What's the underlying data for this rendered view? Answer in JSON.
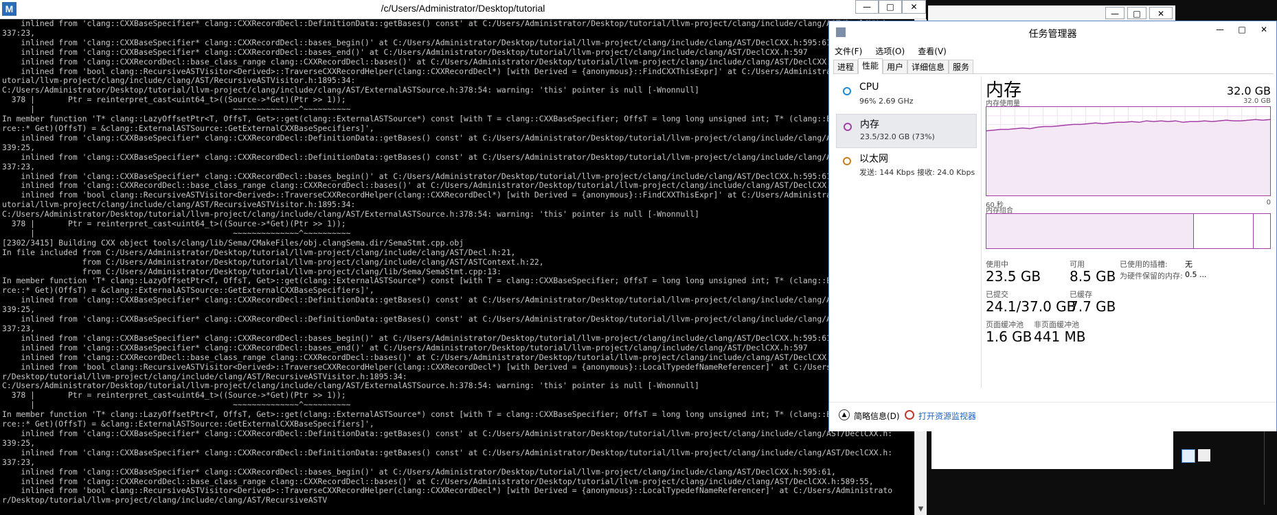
{
  "terminal": {
    "title": "/c/Users/Administrator/Desktop/tutorial",
    "app_icon": "M",
    "buttons": {
      "minimize": "—",
      "maximize": "□",
      "close": "✕"
    },
    "lines": [
      "    inlined from 'clang::CXXBaseSpecifier* clang::CXXRecordDecl::DefinitionData::getBases() const' at C:/Users/Administrator/Desktop/tutorial/llvm-project/clang/include/clang/AST/DeclCXX.h:",
      "337:23,",
      "    inlined from 'clang::CXXBaseSpecifier* clang::CXXRecordDecl::bases_begin()' at C:/Users/Administrator/Desktop/tutorial/llvm-project/clang/include/clang/AST/DeclCXX.h:595:61,",
      "    inlined from 'clang::CXXBaseSpecifier* clang::CXXRecordDecl::bases_end()' at C:/Users/Administrator/Desktop/tutorial/llvm-project/clang/include/clang/AST/DeclCXX.h:597",
      "    inlined from 'clang::CXXRecordDecl::base_class_range clang::CXXRecordDecl::bases()' at C:/Users/Administrator/Desktop/tutorial/llvm-project/clang/include/clang/AST/DeclCXX.h:589:55,",
      "    inlined from 'bool clang::RecursiveASTVisitor<Derived>::TraverseCXXRecordHelper(clang::CXXRecordDecl*) [with Derived = {anonymous}::FindCXXThisExpr]' at C:/Users/Administrator/Desktop/",
      "utorial/llvm-project/clang/include/clang/AST/RecursiveASTVisitor.h:1895:34:",
      "C:/Users/Administrator/Desktop/tutorial/llvm-project/clang/include/clang/AST/ExternalASTSource.h:378:54: warning: 'this' pointer is null [-Wnonnull]",
      "  378 |       Ptr = reinterpret_cast<uint64_t>((Source->*Get)(Ptr >> 1));",
      "      |                                          ~~~~~~~~~~~~~~^~~~~~~~~~~",
      "In member function 'T* clang::LazyOffsetPtr<T, OffsT, Get>::get(clang::ExternalASTSource*) const [with T = clang::CXXBaseSpecifier; OffsT = long long unsigned int; T* (clang::ExternalASTSou",
      "rce::* Get)(OffsT) = &clang::ExternalASTSource::GetExternalCXXBaseSpecifiers]',",
      "    inlined from 'clang::CXXBaseSpecifier* clang::CXXRecordDecl::DefinitionData::getBases() const' at C:/Users/Administrator/Desktop/tutorial/llvm-project/clang/include/clang/AST/DeclCXX.h:",
      "339:25,",
      "    inlined from 'clang::CXXBaseSpecifier* clang::CXXRecordDecl::DefinitionData::getBases() const' at C:/Users/Administrator/Desktop/tutorial/llvm-project/clang/include/clang/AST/DeclCXX.h:",
      "337:23,",
      "    inlined from 'clang::CXXBaseSpecifier* clang::CXXRecordDecl::bases_begin()' at C:/Users/Administrator/Desktop/tutorial/llvm-project/clang/include/clang/AST/DeclCXX.h:595:61,",
      "    inlined from 'clang::CXXRecordDecl::base_class_range clang::CXXRecordDecl::bases()' at C:/Users/Administrator/Desktop/tutorial/llvm-project/clang/include/clang/AST/DeclCXX.h:589:55,",
      "    inlined from 'bool clang::RecursiveASTVisitor<Derived>::TraverseCXXRecordHelper(clang::CXXRecordDecl*) [with Derived = {anonymous}::FindCXXThisExpr]' at C:/Users/Administrator/Desktop/",
      "utorial/llvm-project/clang/include/clang/AST/RecursiveASTVisitor.h:1895:34:",
      "C:/Users/Administrator/Desktop/tutorial/llvm-project/clang/include/clang/AST/ExternalASTSource.h:378:54: warning: 'this' pointer is null [-Wnonnull]",
      "  378 |       Ptr = reinterpret_cast<uint64_t>((Source->*Get)(Ptr >> 1));",
      "      |                                          ~~~~~~~~~~~~~~^~~~~~~~~~~",
      "[2302/3415] Building CXX object tools/clang/lib/Sema/CMakeFiles/obj.clangSema.dir/SemaStmt.cpp.obj",
      "In file included from C:/Users/Administrator/Desktop/tutorial/llvm-project/clang/include/clang/AST/Decl.h:21,",
      "                 from C:/Users/Administrator/Desktop/tutorial/llvm-project/clang/include/clang/AST/ASTContext.h:22,",
      "                 from C:/Users/Administrator/Desktop/tutorial/llvm-project/clang/lib/Sema/SemaStmt.cpp:13:",
      "In member function 'T* clang::LazyOffsetPtr<T, OffsT, Get>::get(clang::ExternalASTSource*) const [with T = clang::CXXBaseSpecifier; OffsT = long long unsigned int; T* (clang::ExternalASTSou",
      "rce::* Get)(OffsT) = &clang::ExternalASTSource::GetExternalCXXBaseSpecifiers]',",
      "    inlined from 'clang::CXXBaseSpecifier* clang::CXXRecordDecl::DefinitionData::getBases() const' at C:/Users/Administrator/Desktop/tutorial/llvm-project/clang/include/clang/AST/DeclCXX.h:",
      "339:25,",
      "    inlined from 'clang::CXXBaseSpecifier* clang::CXXRecordDecl::DefinitionData::getBases() const' at C:/Users/Administrator/Desktop/tutorial/llvm-project/clang/include/clang/AST/DeclCXX.h:",
      "337:23,",
      "    inlined from 'clang::CXXBaseSpecifier* clang::CXXRecordDecl::bases_begin()' at C:/Users/Administrator/Desktop/tutorial/llvm-project/clang/include/clang/AST/DeclCXX.h:595:61,",
      "    inlined from 'clang::CXXBaseSpecifier* clang::CXXRecordDecl::bases_end()' at C:/Users/Administrator/Desktop/tutorial/llvm-project/clang/include/clang/AST/DeclCXX.h:597",
      "    inlined from 'clang::CXXRecordDecl::base_class_range clang::CXXRecordDecl::bases()' at C:/Users/Administrator/Desktop/tutorial/llvm-project/clang/include/clang/AST/DeclCXX.h:589:55,",
      "    inlined from 'bool clang::RecursiveASTVisitor<Derived>::TraverseCXXRecordHelper(clang::CXXRecordDecl*) [with Derived = {anonymous}::LocalTypedefNameReferencer]' at C:/Users/Administrato",
      "r/Desktop/tutorial/llvm-project/clang/include/clang/AST/RecursiveASTVisitor.h:1895:34:",
      "C:/Users/Administrator/Desktop/tutorial/llvm-project/clang/include/clang/AST/ExternalASTSource.h:378:54: warning: 'this' pointer is null [-Wnonnull]",
      "  378 |       Ptr = reinterpret_cast<uint64_t>((Source->*Get)(Ptr >> 1));",
      "      |                                          ~~~~~~~~~~~~~~^~~~~~~~~~~",
      "In member function 'T* clang::LazyOffsetPtr<T, OffsT, Get>::get(clang::ExternalASTSource*) const [with T = clang::CXXBaseSpecifier; OffsT = long long unsigned int; T* (clang::ExternalASTSou",
      "rce::* Get)(OffsT) = &clang::ExternalASTSource::GetExternalCXXBaseSpecifiers]',",
      "    inlined from 'clang::CXXBaseSpecifier* clang::CXXRecordDecl::DefinitionData::getBases() const' at C:/Users/Administrator/Desktop/tutorial/llvm-project/clang/include/clang/AST/DeclCXX.h:",
      "339:25,",
      "    inlined from 'clang::CXXBaseSpecifier* clang::CXXRecordDecl::DefinitionData::getBases() const' at C:/Users/Administrator/Desktop/tutorial/llvm-project/clang/include/clang/AST/DeclCXX.h:",
      "337:23,",
      "    inlined from 'clang::CXXBaseSpecifier* clang::CXXRecordDecl::bases_begin()' at C:/Users/Administrator/Desktop/tutorial/llvm-project/clang/include/clang/AST/DeclCXX.h:595:61,",
      "    inlined from 'clang::CXXRecordDecl::base_class_range clang::CXXRecordDecl::bases()' at C:/Users/Administrator/Desktop/tutorial/llvm-project/clang/include/clang/AST/DeclCXX.h:589:55,",
      "    inlined from 'bool clang::RecursiveASTVisitor<Derived>::TraverseCXXRecordHelper(clang::CXXRecordDecl*) [with Derived = {anonymous}::LocalTypedefNameReferencer]' at C:/Users/Administrato",
      "r/Desktop/tutorial/llvm-project/clang/include/clang/AST/RecursiveASTV"
    ]
  },
  "taskmgr": {
    "title": "任务管理器",
    "buttons": {
      "minimize": "—",
      "maximize": "□",
      "close": "✕"
    },
    "menus": [
      "文件(F)",
      "选项(O)",
      "查看(V)"
    ],
    "tabs": [
      "进程",
      "性能",
      "用户",
      "详细信息",
      "服务"
    ],
    "active_tab": "性能",
    "resources": [
      {
        "name": "CPU",
        "sub": "96%  2.69 GHz",
        "color": "#1e88d8"
      },
      {
        "name": "内存",
        "sub": "23.5/32.0 GB (73%)",
        "color": "#a53da9"
      },
      {
        "name": "以太网",
        "sub": "发送: 144 Kbps  接收: 24.0 Kbps",
        "color": "#c87d1e"
      }
    ],
    "memory": {
      "heading": "内存",
      "total": "32.0 GB",
      "usage_label": "内存使用量",
      "usage_max": "32.0 GB",
      "time_left": "60 秒",
      "time_right": "0",
      "composition_label": "内存组合",
      "in_use_label": "使用中",
      "in_use": "23.5 GB",
      "available_label": "可用",
      "available": "8.5 GB",
      "committed_label": "已提交",
      "committed": "24.1/37.0 GB",
      "cached_label": "已缓存",
      "cached": "7.7 GB",
      "paged_label": "页面缓冲池",
      "paged": "1.6 GB",
      "nonpaged_label": "非页面缓冲池",
      "nonpaged": "441 MB",
      "slots_label": "已使用的插槽:",
      "slots_value": "无",
      "reserved_label": "为硬件保留的内存:",
      "reserved_value": "0.5 ...",
      "accent": "#a53da9",
      "fill": "#f3e8f4",
      "usage_history_fraction": [
        0.72,
        0.73,
        0.74,
        0.74,
        0.75,
        0.76,
        0.75,
        0.77,
        0.78,
        0.78,
        0.79,
        0.8,
        0.81,
        0.81,
        0.82,
        0.83,
        0.82,
        0.83,
        0.84,
        0.84,
        0.85,
        0.84,
        0.86,
        0.85,
        0.86,
        0.85,
        0.86,
        0.84,
        0.85,
        0.85,
        0.86,
        0.85,
        0.86,
        0.87,
        0.86,
        0.86,
        0.87,
        0.88,
        0.87,
        0.88
      ],
      "composition_in_use_fraction": 0.73,
      "composition_modified_fraction": 0.04
    },
    "footer": {
      "less_label": "简略信息(D)",
      "monitor_link": "打开资源监视器"
    }
  }
}
